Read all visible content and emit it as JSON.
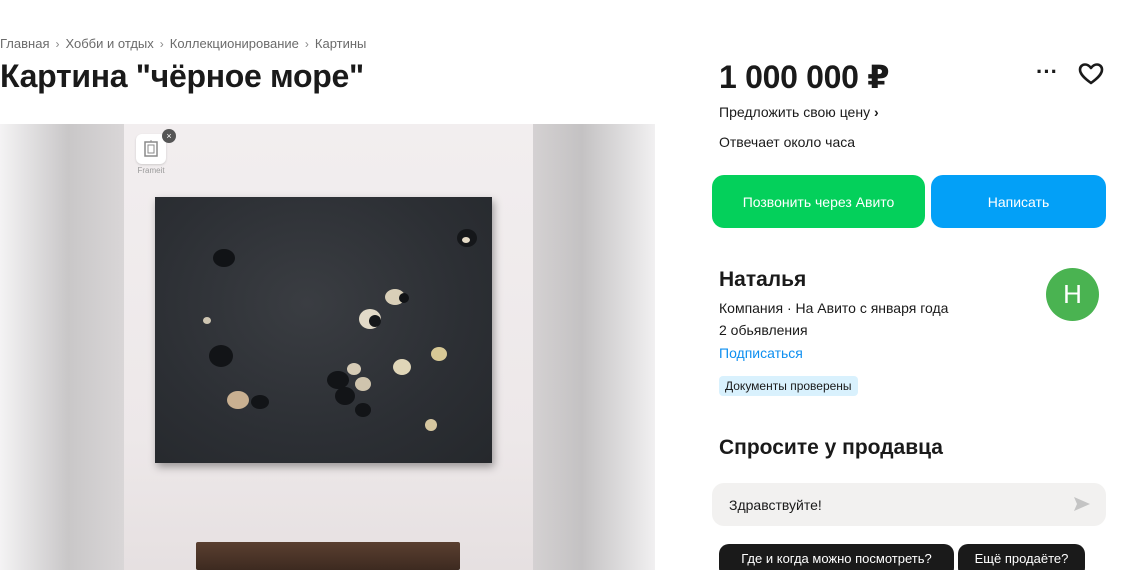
{
  "breadcrumb": [
    "Главная",
    "Хобби и отдых",
    "Коллекционирование",
    "Картины"
  ],
  "listing": {
    "title": "Картина \"чёрное море\"",
    "price": "1 000 000 ₽",
    "offer_link": "Предложить свою цену",
    "response_time": "Отвечает около часа"
  },
  "actions": {
    "call_label": "Позвонить через Авито",
    "write_label": "Написать",
    "more_icon": "more-horizontal-icon",
    "favorite_icon": "heart-icon"
  },
  "gallery": {
    "overlay_label": "Frameit",
    "overlay_icon": "frame-icon",
    "close_glyph": "×"
  },
  "seller": {
    "name": "Наталья",
    "info": "Компания · На Авито с января года",
    "ads": "2 обьявления",
    "subscribe": "Подписаться",
    "badge": "Документы проверены",
    "avatar_letter": "Н",
    "avatar_color": "#4ab351"
  },
  "ask": {
    "title": "Спросите у продавца",
    "message_value": "Здравствуйте!",
    "send_icon": "send-icon",
    "chips": [
      "Где и когда можно посмотреть?",
      "Ещё продаёте?"
    ]
  },
  "colors": {
    "call_button": "#04d05b",
    "write_button": "#03a0f7",
    "link": "#0e8ff0"
  }
}
